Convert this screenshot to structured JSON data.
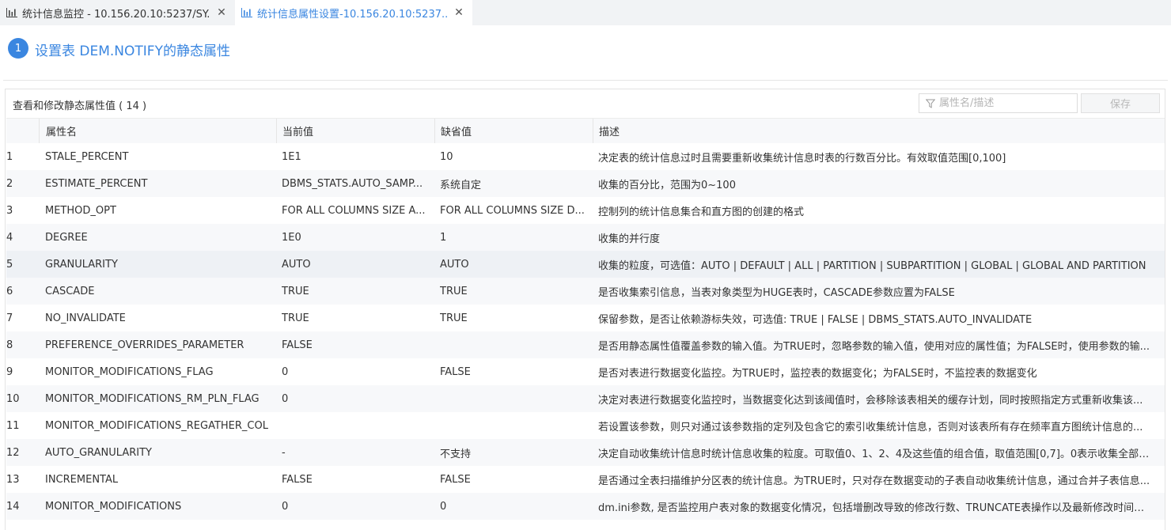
{
  "tabs": [
    {
      "label": "统计信息监控 - 10.156.20.10:5237/SY..."
    },
    {
      "label": "统计信息属性设置-10.156.20.10:5237..."
    }
  ],
  "header": {
    "step": "1",
    "title": "设置表 DEM.NOTIFY的静态属性"
  },
  "panel": {
    "title": "查看和修改静态属性值 ( 14 )",
    "filter_placeholder": "属性名/描述",
    "save_label": "保存"
  },
  "table": {
    "columns": [
      "属性名",
      "当前值",
      "缺省值",
      "描述"
    ],
    "rows": [
      {
        "idx": "1",
        "name": "STALE_PERCENT",
        "current": "1E1",
        "default": "10",
        "desc": "决定表的统计信息过时且需要重新收集统计信息时表的行数百分比。有效取值范围[0,100]"
      },
      {
        "idx": "2",
        "name": "ESTIMATE_PERCENT",
        "current": "DBMS_STATS.AUTO_SAMP...",
        "default": "系统自定",
        "desc": "收集的百分比，范围为0~100"
      },
      {
        "idx": "3",
        "name": "METHOD_OPT",
        "current": "FOR ALL COLUMNS SIZE A...",
        "default": "FOR ALL COLUMNS SIZE D...",
        "desc": "控制列的统计信息集合和直方图的创建的格式"
      },
      {
        "idx": "4",
        "name": "DEGREE",
        "current": "1E0",
        "default": "1",
        "desc": "收集的并行度"
      },
      {
        "idx": "5",
        "name": "GRANULARITY",
        "current": "AUTO",
        "default": "AUTO",
        "desc": "收集的粒度，可选值：AUTO | DEFAULT | ALL | PARTITION | SUBPARTITION | GLOBAL | GLOBAL AND PARTITION"
      },
      {
        "idx": "6",
        "name": "CASCADE",
        "current": "TRUE",
        "default": "TRUE",
        "desc": "是否收集索引信息，当表对象类型为HUGE表时，CASCADE参数应置为FALSE"
      },
      {
        "idx": "7",
        "name": "NO_INVALIDATE",
        "current": "TRUE",
        "default": "TRUE",
        "desc": "保留参数，是否让依赖游标失效，可选值: TRUE | FALSE | DBMS_STATS.AUTO_INVALIDATE"
      },
      {
        "idx": "8",
        "name": "PREFERENCE_OVERRIDES_PARAMETER",
        "current": "FALSE",
        "default": "",
        "desc": "是否用静态属性值覆盖参数的输入值。为TRUE时，忽略参数的输入值，使用对应的属性值；为FALSE时，使用参数的输..."
      },
      {
        "idx": "9",
        "name": "MONITOR_MODIFICATIONS_FLAG",
        "current": "0",
        "default": "FALSE",
        "desc": "是否对表进行数据变化监控。为TRUE时，监控表的数据变化；为FALSE时，不监控表的数据变化"
      },
      {
        "idx": "10",
        "name": "MONITOR_MODIFICATIONS_RM_PLN_FLAG",
        "current": "0",
        "default": "",
        "desc": "决定对表进行数据变化监控时，当数据变化达到该阈值时，会移除该表相关的缓存计划，同时按照指定方式重新收集该..."
      },
      {
        "idx": "11",
        "name": "MONITOR_MODIFICATIONS_REGATHER_COL",
        "current": "",
        "default": "",
        "desc": "若设置该参数，则只对通过该参数指的定列及包含它的索引收集统计信息，否则对该表所有存在频率直方图统计信息的..."
      },
      {
        "idx": "12",
        "name": "AUTO_GRANULARITY",
        "current": "-",
        "default": "不支持",
        "desc": "决定自动收集统计信息时统计信息收集的粒度。可取值0、1、2、4及这些值的组合值，取值范围[0,7]。0表示收集全部统..."
      },
      {
        "idx": "13",
        "name": "INCREMENTAL",
        "current": "FALSE",
        "default": "FALSE",
        "desc": "是否通过全表扫描维护分区表的统计信息。为TRUE时，只对存在数据变动的子表自动收集统计信息，通过合并子表信息..."
      },
      {
        "idx": "14",
        "name": "MONITOR_MODIFICATIONS",
        "current": "0",
        "default": "0",
        "desc": "dm.ini参数, 是否监控用户表对象的数据变化情况，包括增删改导致的修改行数、TRUNCATE表操作以及最新修改时间等..."
      }
    ]
  },
  "colors": {
    "accent": "#3a86e0",
    "row_highlight": "#eef1f5",
    "zebra": "#f7f8fa"
  },
  "icons": {
    "tab_icon": "bar-chart-icon",
    "close": "close-icon",
    "filter": "filter-icon"
  }
}
